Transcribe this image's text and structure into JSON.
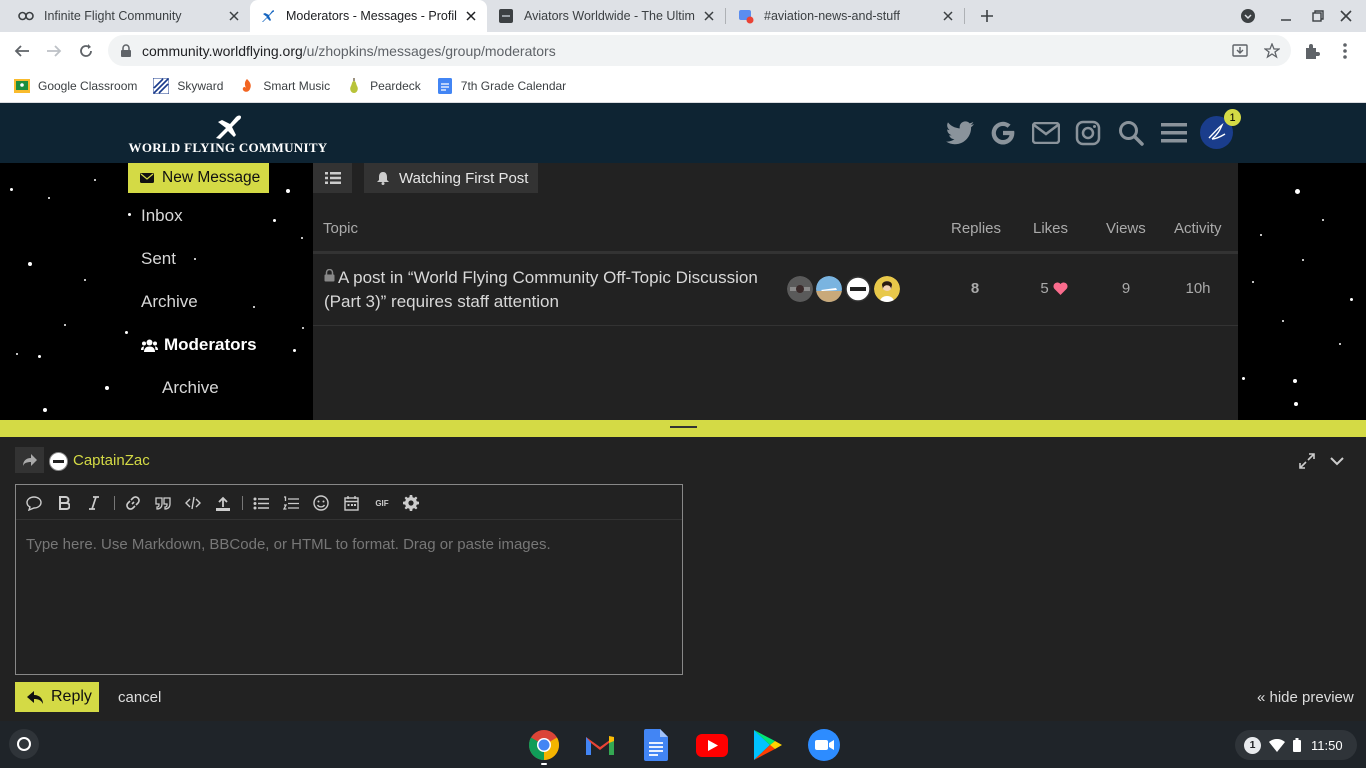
{
  "browser": {
    "tabs": [
      {
        "title": "Infinite Flight Community"
      },
      {
        "title": "Moderators - Messages - Profile -"
      },
      {
        "title": "Aviators Worldwide - The Ultimat"
      },
      {
        "title": "#aviation-news-and-stuff"
      }
    ],
    "url": {
      "host": "community.worldflying.org",
      "path": "/u/zhopkins/messages/group/moderators"
    },
    "bookmarks": [
      {
        "label": "Google Classroom"
      },
      {
        "label": "Skyward"
      },
      {
        "label": "Smart Music"
      },
      {
        "label": "Peardeck"
      },
      {
        "label": "7th Grade Calendar"
      }
    ]
  },
  "site": {
    "logo_text": "WORLD FLYING COMMUNITY",
    "notification_count": "1"
  },
  "sidebar": {
    "new_message": "New Message",
    "items": [
      {
        "label": "Inbox"
      },
      {
        "label": "Sent"
      },
      {
        "label": "Archive"
      },
      {
        "label": "Moderators"
      },
      {
        "label": "Archive"
      }
    ]
  },
  "main": {
    "watch_label": "Watching First Post",
    "columns": {
      "topic": "Topic",
      "replies": "Replies",
      "likes": "Likes",
      "views": "Views",
      "activity": "Activity"
    },
    "topics": [
      {
        "title": "A post in “World Flying Community Off-Topic Discussion (Part 3)” requires staff attention",
        "replies": "8",
        "likes": "5",
        "views": "9",
        "activity": "10h"
      }
    ]
  },
  "composer": {
    "user": "CaptainZac",
    "placeholder": "Type here. Use Markdown, BBCode, or HTML to format. Drag or paste images.",
    "reply_label": "Reply",
    "cancel_label": "cancel",
    "hide_preview_label": "« hide preview",
    "gif_label": "GIF"
  },
  "shelf": {
    "time": "11:50",
    "notifications": "1"
  },
  "colors": {
    "accent": "#d4da45",
    "header": "#0e2433",
    "panel": "#222222"
  }
}
